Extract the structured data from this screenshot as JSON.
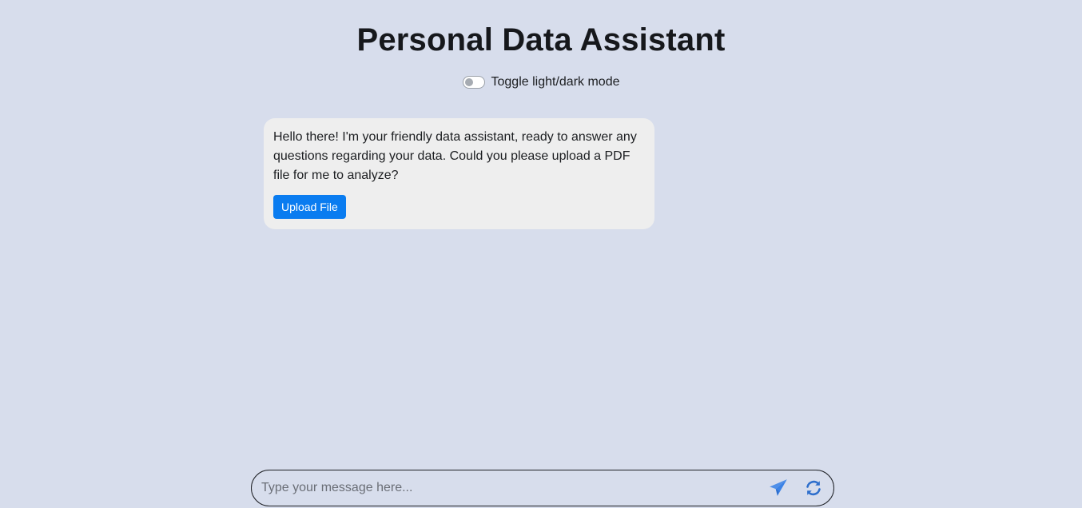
{
  "header": {
    "title": "Personal Data Assistant",
    "toggle_label": "Toggle light/dark mode",
    "dark_mode_enabled": false
  },
  "chat": {
    "messages": [
      {
        "sender": "assistant",
        "text": "Hello there! I'm your friendly data assistant, ready to answer any questions regarding your data. Could you please upload a PDF file for me to analyze?",
        "action_label": "Upload File"
      }
    ]
  },
  "composer": {
    "placeholder": "Type your message here...",
    "value": "",
    "send_icon": "paper-plane-icon",
    "refresh_icon": "refresh-icon"
  },
  "colors": {
    "background": "#d7ddec",
    "bubble": "#eeeeee",
    "accent": "#0a7cf0",
    "icon": "#3b82e6"
  }
}
